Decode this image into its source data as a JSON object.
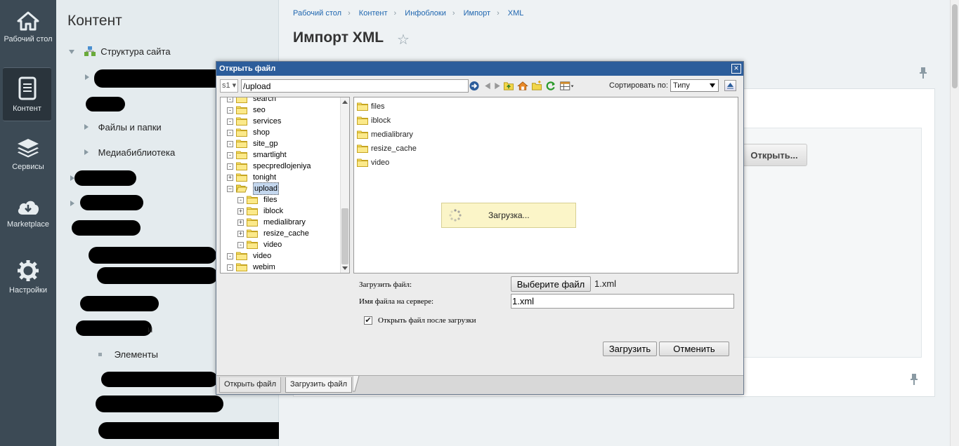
{
  "leftnav": {
    "items": [
      {
        "label": "Рабочий стол",
        "icon": "home-icon"
      },
      {
        "label": "Контент",
        "icon": "document-icon"
      },
      {
        "label": "Сервисы",
        "icon": "layers-icon"
      },
      {
        "label": "Marketplace",
        "icon": "cloud-download-icon"
      },
      {
        "label": "Настройки",
        "icon": "gear-icon"
      }
    ]
  },
  "sidebar": {
    "title": "Контент",
    "site_structure": "Структура сайта",
    "files_folders": "Файлы и папки",
    "media_library": "Медиабиблиотека",
    "partial_label": "и",
    "elements": "Элементы"
  },
  "breadcrumb": [
    "Рабочий стол",
    "Контент",
    "Инфоблоки",
    "Импорт",
    "XML"
  ],
  "page": {
    "title": "Импорт XML",
    "open_button": "Открыть..."
  },
  "dialog": {
    "title": "Открыть файл",
    "site": "s1",
    "path": "/upload",
    "sort_label": "Сортировать по:",
    "sort_value": "Типу",
    "tree": [
      {
        "name": "search",
        "exp": "-"
      },
      {
        "name": "seo",
        "exp": "-"
      },
      {
        "name": "services",
        "exp": "-"
      },
      {
        "name": "shop",
        "exp": "-"
      },
      {
        "name": "site_gp",
        "exp": "-"
      },
      {
        "name": "smartlight",
        "exp": "-"
      },
      {
        "name": "specpredlojeniya",
        "exp": "-"
      },
      {
        "name": "tonight",
        "exp": "+"
      },
      {
        "name": "upload",
        "exp": "−"
      },
      {
        "name": "files",
        "exp": "-"
      },
      {
        "name": "iblock",
        "exp": "+"
      },
      {
        "name": "medialibrary",
        "exp": "+"
      },
      {
        "name": "resize_cache",
        "exp": "+"
      },
      {
        "name": "video",
        "exp": "-"
      },
      {
        "name": "video",
        "exp": "-"
      },
      {
        "name": "webim",
        "exp": "-"
      }
    ],
    "files": [
      "files",
      "iblock",
      "medialibrary",
      "resize_cache",
      "video"
    ],
    "loading": "Загрузка...",
    "upload_label": "Загрузить файл:",
    "choose_button": "Выберите файл",
    "chosen_file": "1.xml",
    "server_name_label": "Имя файла на сервере:",
    "server_name_value": "1.xml",
    "open_after_label": "Открыть файл после загрузки",
    "upload_button": "Загрузить",
    "cancel_button": "Отменить",
    "tab_open": "Открыть файл",
    "tab_upload": "Загрузить файл"
  },
  "colors": {
    "nav_bg": "#3c4a55",
    "dialog_title_bg": "#2c5d9b",
    "link": "#2067b0",
    "loading_bg": "#fbf5c8"
  }
}
